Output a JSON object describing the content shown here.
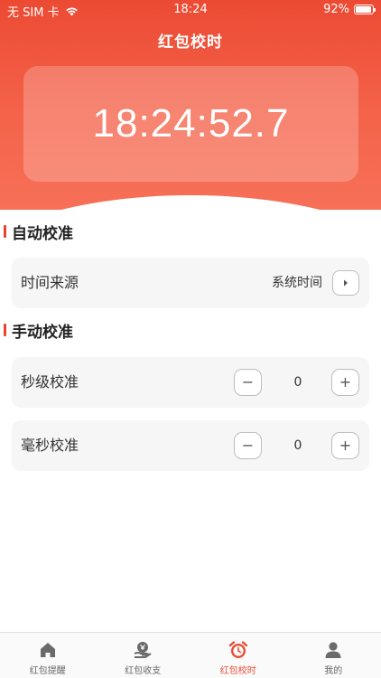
{
  "status_bar": {
    "carrier": "无 SIM 卡",
    "time": "18:24",
    "battery": "92%",
    "battery_level": 0.92
  },
  "header": {
    "title": "红包校时",
    "clock": "18:24:52.7"
  },
  "sections": {
    "auto": {
      "title": "自动校准",
      "time_source_label": "时间来源",
      "time_source_value": "系统时间"
    },
    "manual": {
      "title": "手动校准",
      "seconds_label": "秒级校准",
      "seconds_value": "0",
      "millis_label": "毫秒校准",
      "millis_value": "0",
      "minus_glyph": "−",
      "plus_glyph": "+"
    }
  },
  "tabbar": {
    "items": [
      {
        "label": "红包提醒",
        "icon": "home-icon"
      },
      {
        "label": "红包收支",
        "icon": "wallet-icon"
      },
      {
        "label": "红包校时",
        "icon": "alarm-clock-icon",
        "active": true
      },
      {
        "label": "我的",
        "icon": "user-icon"
      }
    ]
  },
  "colors": {
    "accent": "#ea4b33",
    "hero_top": "#ec4a33",
    "hero_bottom": "#f77058",
    "row_bg": "#f6f6f6"
  }
}
